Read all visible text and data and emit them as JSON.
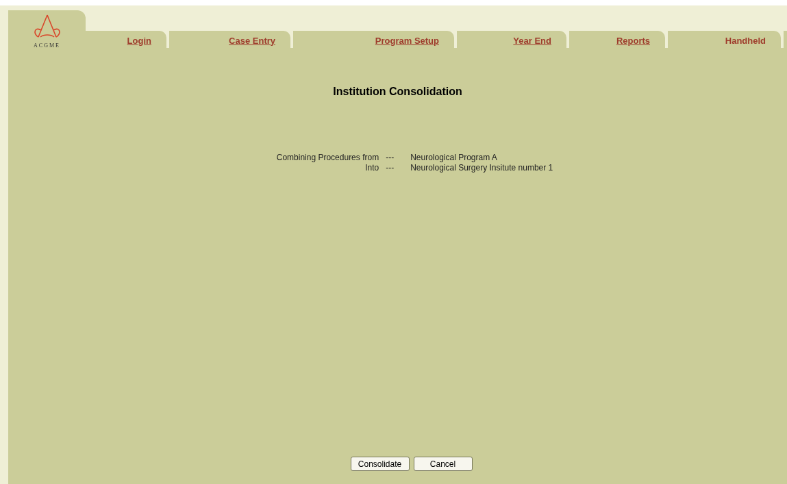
{
  "logo": {
    "text": "ACGME"
  },
  "tabs": [
    {
      "label": "Login",
      "link": true
    },
    {
      "label": "Case Entry",
      "link": true
    },
    {
      "label": "Program Setup",
      "link": true
    },
    {
      "label": "Year End",
      "link": true
    },
    {
      "label": "Reports",
      "link": true
    },
    {
      "label": "Handheld",
      "link": false
    }
  ],
  "title": "Institution Consolidation",
  "details": [
    {
      "label": "Combining Procedures from",
      "separator": "---",
      "value": "Neurological Program A"
    },
    {
      "label": "Into",
      "separator": "---",
      "value": "Neurological Surgery Insitute number 1"
    }
  ],
  "buttons": [
    "Consolidate",
    "Cancel"
  ]
}
